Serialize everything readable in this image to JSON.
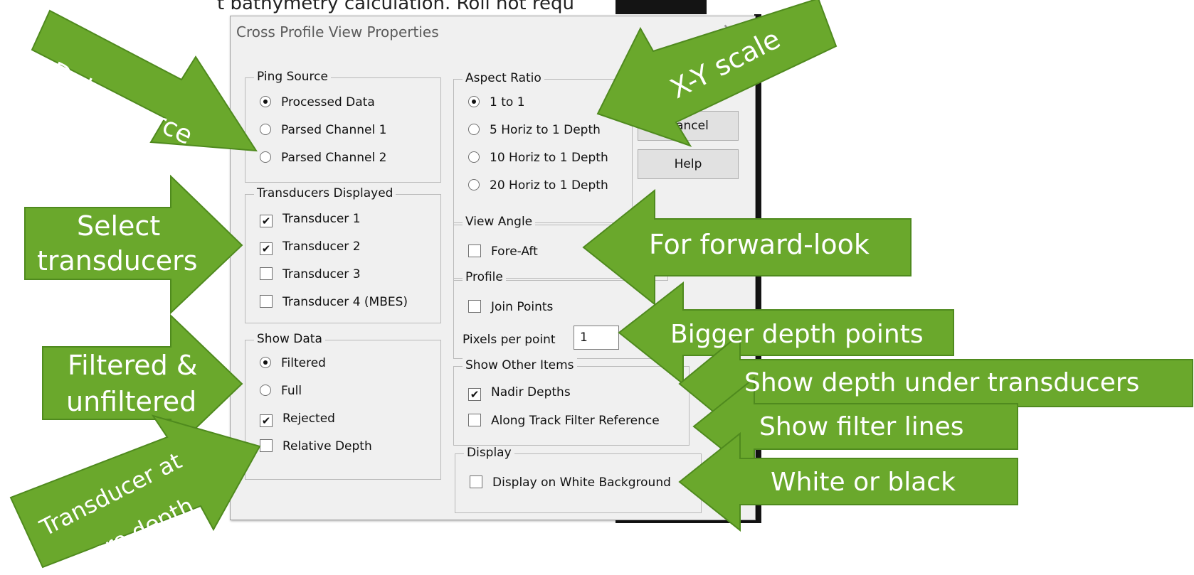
{
  "background": {
    "top_text": "t bathymetry calculation. Roll not requ"
  },
  "dialog": {
    "title": "Cross Profile View Properties",
    "close_glyph": "✕",
    "ping_source": {
      "legend": "Ping Source",
      "options": [
        "Processed Data",
        "Parsed Channel 1",
        "Parsed Channel 2"
      ],
      "selected_index": 0
    },
    "transducers": {
      "legend": "Transducers Displayed",
      "items": [
        {
          "label": "Transducer 1",
          "checked": true
        },
        {
          "label": "Transducer 2",
          "checked": true
        },
        {
          "label": "Transducer 3",
          "checked": false
        },
        {
          "label": "Transducer 4 (MBES)",
          "checked": false
        }
      ]
    },
    "show_data": {
      "legend": "Show Data",
      "options": [
        "Filtered",
        "Full"
      ],
      "selected_index": 0,
      "rejected": {
        "label": "Rejected",
        "checked": true
      },
      "relative_depth": {
        "label": "Relative Depth",
        "checked": false
      }
    },
    "aspect_ratio": {
      "legend": "Aspect Ratio",
      "options": [
        "1 to 1",
        "5 Horiz to 1 Depth",
        "10 Horiz to 1 Depth",
        "20 Horiz to 1 Depth"
      ],
      "selected_index": 0
    },
    "view_angle": {
      "legend": "View Angle",
      "fore_aft": {
        "label": "Fore-Aft",
        "checked": false
      }
    },
    "profile": {
      "legend": "Profile",
      "join_points": {
        "label": "Join Points",
        "checked": false
      },
      "pixels_label": "Pixels per point",
      "pixels_value": "1"
    },
    "other_items": {
      "legend": "Show Other Items",
      "nadir": {
        "label": "Nadir Depths",
        "checked": true
      },
      "along_track": {
        "label": "Along Track Filter Reference",
        "checked": false
      }
    },
    "display": {
      "legend": "Display",
      "white_bg": {
        "label": "Display on White Background",
        "checked": false
      }
    },
    "buttons": {
      "cancel": "Cancel",
      "help": "Help"
    }
  },
  "callouts": {
    "data_source": "Data source",
    "xy_scale": "X-Y scale",
    "select_transducers_1": "Select",
    "select_transducers_2": "transducers",
    "forward_look": "For forward-look",
    "filtered_1": "Filtered &",
    "filtered_2": "unfiltered",
    "bigger_points": "Bigger depth points",
    "depth_under": "Show depth under transducers",
    "filter_lines": "Show filter lines",
    "white_black": "White or black",
    "transducer_zero_1": "Transducer at",
    "transducer_zero_2": "zero depth"
  },
  "colors": {
    "arrow_fill": "#6aa82c",
    "arrow_border": "#4f8a1e",
    "dialog_bg": "#f0f0f0"
  }
}
